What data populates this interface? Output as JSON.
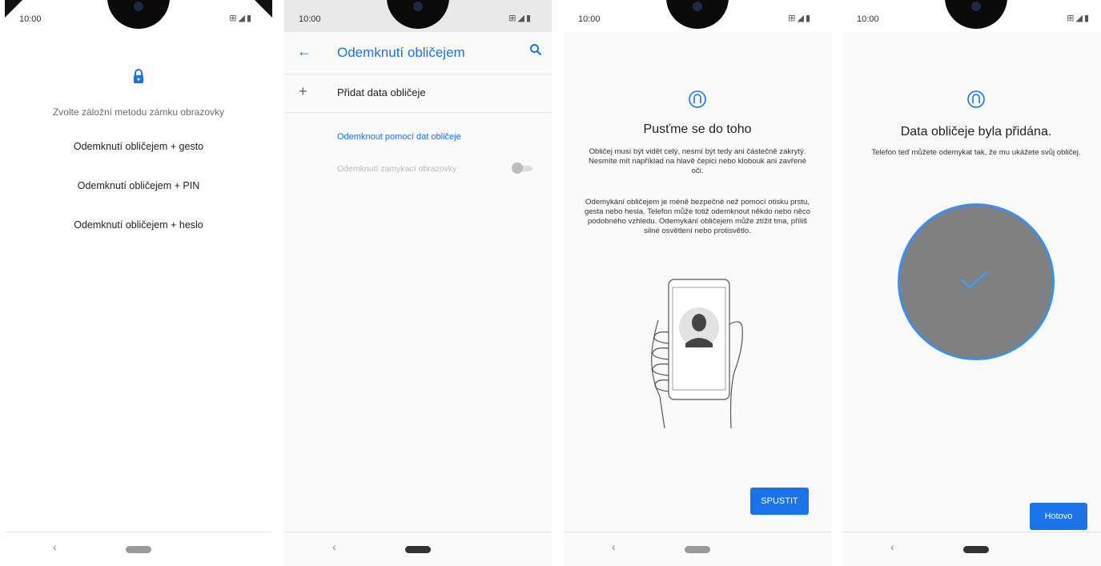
{
  "status": {
    "time": "10:00"
  },
  "screen1": {
    "title": "Zvolte záložní metodu zámku obrazovky",
    "options": [
      "Odemknutí obličejem + gesto",
      "Odemknutí obličejem + PIN",
      "Odemknutí obličejem + heslo"
    ]
  },
  "screen2": {
    "app_title": "Odemknutí obličejem",
    "add_face_data": "Přidat data obličeje",
    "section_header": "Odemknout pomocí dat obličeje",
    "toggle_label": "Odemknutí zamykací obrazovky",
    "toggle_on": false
  },
  "screen3": {
    "heading": "Pusťme se do toho",
    "paragraph1": "Obličej musí být vidět celý, nesmí být tedy ani částečně zakrytý. Nesmíte mít například na hlavě čepici nebo klobouk ani zavřené oči.",
    "paragraph2": "Odemykání obličejem je méně bezpečné než pomocí otisku prstu, gesta nebo hesla. Telefon může totiž odemknout někdo nebo něco podobného vzhledu. Odemykání obličejem může ztížit tma, příliš silné osvětlení nebo protisvětlo.",
    "start_button": "SPUSTIT"
  },
  "screen4": {
    "heading": "Data obličeje byla přidána.",
    "paragraph": "Telefon teď můžete odemykat tak, že mu ukážete svůj obličej.",
    "done_button": "Hotovo"
  },
  "colors": {
    "accent": "#1a73e8",
    "circle": "#808080",
    "circle_border": "#3b8ff0"
  },
  "icons": [
    "lock-icon",
    "back-arrow-icon",
    "search-icon",
    "plus-icon",
    "face-icon",
    "checkmark-icon",
    "nav-back-icon",
    "nav-home-icon"
  ]
}
